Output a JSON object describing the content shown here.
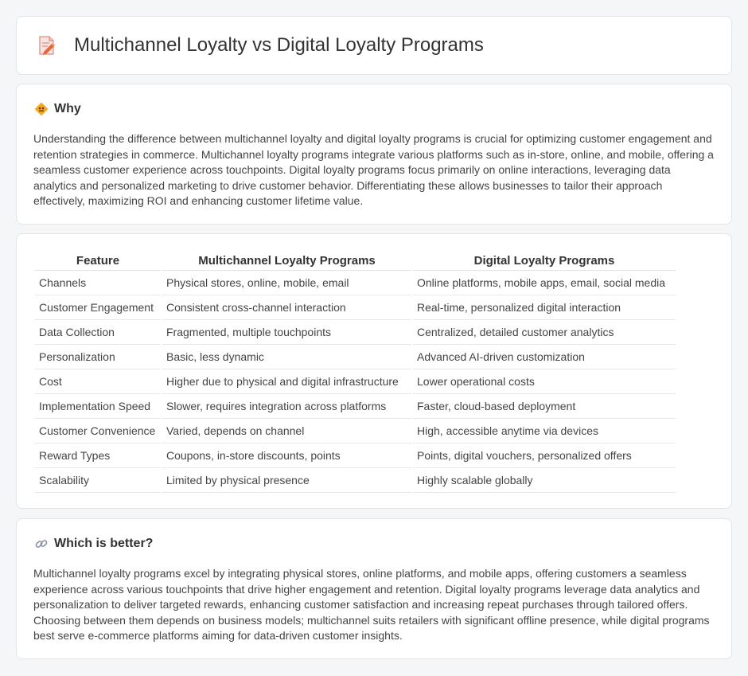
{
  "header": {
    "title": "Multichannel Loyalty vs Digital Loyalty Programs",
    "icon": "document-pencil-icon"
  },
  "why": {
    "title": "Why",
    "icon": "diamond-road-sign-icon",
    "body": "Understanding the difference between multichannel loyalty and digital loyalty programs is crucial for optimizing customer engagement and retention strategies in commerce. Multichannel loyalty programs integrate various platforms such as in-store, online, and mobile, offering a seamless customer experience across touchpoints. Digital loyalty programs focus primarily on online interactions, leveraging data analytics and personalized marketing to drive customer behavior. Differentiating these allows businesses to tailor their approach effectively, maximizing ROI and enhancing customer lifetime value."
  },
  "table": {
    "headers": [
      "Feature",
      "Multichannel Loyalty Programs",
      "Digital Loyalty Programs"
    ],
    "rows": [
      [
        "Channels",
        "Physical stores, online, mobile, email",
        "Online platforms, mobile apps, email, social media"
      ],
      [
        "Customer Engagement",
        "Consistent cross-channel interaction",
        "Real-time, personalized digital interaction"
      ],
      [
        "Data Collection",
        "Fragmented, multiple touchpoints",
        "Centralized, detailed customer analytics"
      ],
      [
        "Personalization",
        "Basic, less dynamic",
        "Advanced AI-driven customization"
      ],
      [
        "Cost",
        "Higher due to physical and digital infrastructure",
        "Lower operational costs"
      ],
      [
        "Implementation Speed",
        "Slower, requires integration across platforms",
        "Faster, cloud-based deployment"
      ],
      [
        "Customer Convenience",
        "Varied, depends on channel",
        "High, accessible anytime via devices"
      ],
      [
        "Reward Types",
        "Coupons, in-store discounts, points",
        "Points, digital vouchers, personalized offers"
      ],
      [
        "Scalability",
        "Limited by physical presence",
        "Highly scalable globally"
      ]
    ]
  },
  "better": {
    "title": "Which is better?",
    "icon": "link-icon",
    "body": "Multichannel loyalty programs excel by integrating physical stores, online platforms, and mobile apps, offering customers a seamless experience across various touchpoints that drive higher engagement and retention. Digital loyalty programs leverage data analytics and personalization to deliver targeted rewards, enhancing customer satisfaction and increasing repeat purchases through tailored offers. Choosing between them depends on business models; multichannel suits retailers with significant offline presence, while digital programs best serve e-commerce platforms aiming for data-driven customer insights."
  }
}
